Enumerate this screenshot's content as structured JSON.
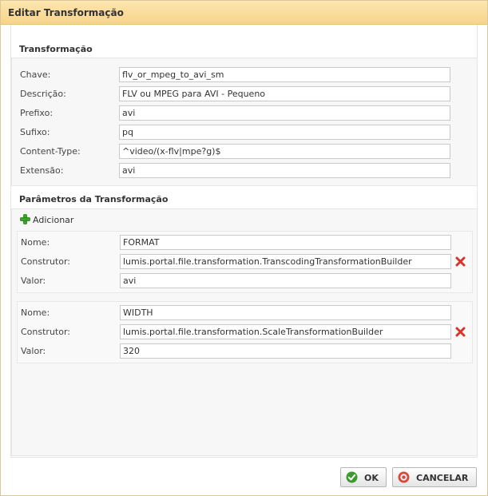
{
  "dialog": {
    "title": "Editar Transformação"
  },
  "transform": {
    "section_title": "Transformação",
    "fields": [
      {
        "label": "Chave:",
        "value": "flv_or_mpeg_to_avi_sm"
      },
      {
        "label": "Descrição:",
        "value": "FLV ou MPEG para AVI - Pequeno"
      },
      {
        "label": "Prefixo:",
        "value": "avi"
      },
      {
        "label": "Sufixo:",
        "value": "pq"
      },
      {
        "label": "Content-Type:",
        "value": "^video/(x-flv|mpe?g)$"
      },
      {
        "label": "Extensão:",
        "value": "avi"
      }
    ]
  },
  "params": {
    "section_title": "Parâmetros da Transformação",
    "add_label": "Adicionar",
    "items": [
      {
        "name_label": "Nome:",
        "name": "FORMAT",
        "builder_label": "Construtor:",
        "builder": "lumis.portal.file.transformation.TranscodingTransformationBuilder",
        "value_label": "Valor:",
        "value": "avi"
      },
      {
        "name_label": "Nome:",
        "name": "WIDTH",
        "builder_label": "Construtor:",
        "builder": "lumis.portal.file.transformation.ScaleTransformationBuilder",
        "value_label": "Valor:",
        "value": "320"
      }
    ]
  },
  "buttons": {
    "ok_label": "OK",
    "cancel_label": "CANCELAR"
  },
  "icons": {
    "add": "plus-icon",
    "delete": "delete-x-icon",
    "ok": "checkmark-icon",
    "cancel": "cancel-circle-icon"
  },
  "colors": {
    "title_bar": "#f8d489",
    "add_green": "#3aa52a",
    "delete_red": "#d8342c",
    "ok_green": "#3c9a2e",
    "cancel_red": "#d94a3e"
  }
}
